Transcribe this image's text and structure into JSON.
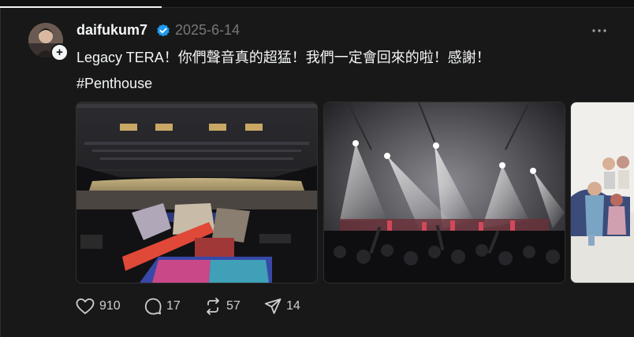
{
  "post": {
    "author": "daifukum7",
    "date": "2025-6-14",
    "text": "Legacy TERA！你們聲音真的超猛！我們一定會回來的啦！感謝！",
    "hashtag": "#Penthouse"
  },
  "actions": {
    "likes": "910",
    "replies": "17",
    "reposts": "57",
    "shares": "14"
  },
  "colors": {
    "background": "#181818",
    "text": "#f3f5f7",
    "muted": "#777777",
    "verified": "#1d9bf0"
  },
  "icons": [
    "verified-badge-icon",
    "more-icon",
    "heart-icon",
    "comment-icon",
    "repost-icon",
    "share-icon",
    "plus-icon"
  ]
}
